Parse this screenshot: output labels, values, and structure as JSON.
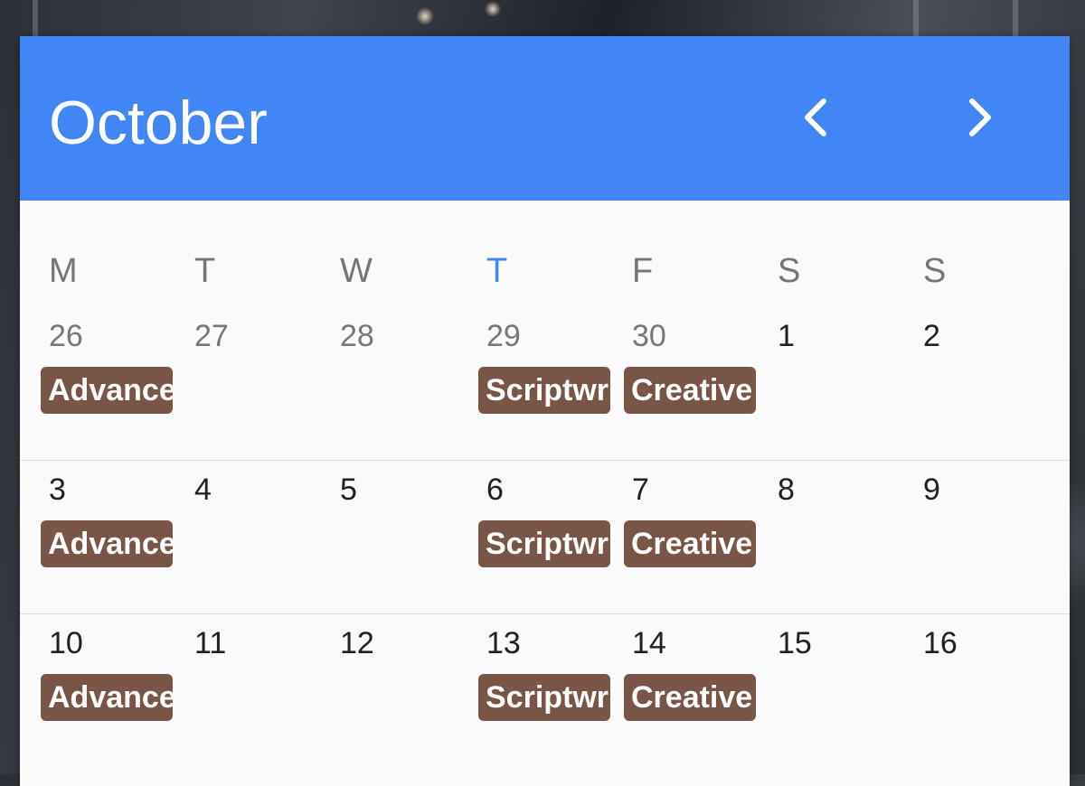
{
  "header": {
    "month": "October",
    "prev_icon": "chevron-left-icon",
    "next_icon": "chevron-right-icon"
  },
  "weekdays": [
    "M",
    "T",
    "W",
    "T",
    "F",
    "S",
    "S"
  ],
  "today_weekday_index": 3,
  "weeks": [
    {
      "days": [
        "26",
        "27",
        "28",
        "29",
        "30",
        "1",
        "2"
      ],
      "other_month": [
        true,
        true,
        true,
        true,
        true,
        false,
        false
      ],
      "events": [
        "Advanced",
        "",
        "",
        "Scriptwriting",
        "Creative",
        "",
        ""
      ]
    },
    {
      "days": [
        "3",
        "4",
        "5",
        "6",
        "7",
        "8",
        "9"
      ],
      "other_month": [
        false,
        false,
        false,
        false,
        false,
        false,
        false
      ],
      "events": [
        "Advanced",
        "",
        "",
        "Scriptwriting",
        "Creative",
        "",
        ""
      ]
    },
    {
      "days": [
        "10",
        "11",
        "12",
        "13",
        "14",
        "15",
        "16"
      ],
      "other_month": [
        false,
        false,
        false,
        false,
        false,
        false,
        false
      ],
      "events": [
        "Advanced",
        "",
        "",
        "Scriptwriting",
        "Creative",
        "",
        ""
      ]
    }
  ],
  "colors": {
    "header": "#4285f4",
    "today": "#4285f4",
    "event": "#795548"
  }
}
